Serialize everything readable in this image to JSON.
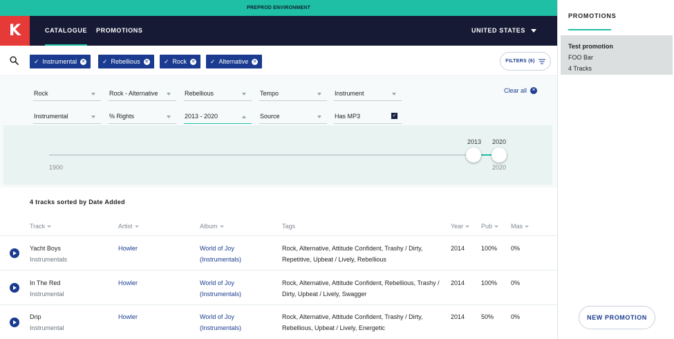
{
  "env_banner": "PREPROD ENVIRONMENT",
  "logo_text": "K",
  "nav": {
    "catalogue": "CATALOGUE",
    "promotions": "PROMOTIONS",
    "country": "UNITED STATES"
  },
  "chips": [
    "Instrumental",
    "Rebellious",
    "Rock",
    "Alternative"
  ],
  "filters_button": "FILTERS (6)",
  "filters": {
    "row1": [
      "Rock",
      "Rock - Alternative",
      "Rebellious",
      "Tempo",
      "Instrument"
    ],
    "row2": [
      "Instrumental",
      "% Rights",
      "2013 - 2020",
      "Source",
      "Has MP3"
    ],
    "clear_all": "Clear all"
  },
  "slider": {
    "min_label": "1900",
    "max_label": "2020",
    "low_value": "2013",
    "high_value": "2020",
    "range_min": 1900,
    "range_max": 2020
  },
  "summary": "4 tracks sorted by Date Added",
  "table": {
    "headers": {
      "track": "Track",
      "artist": "Artist",
      "album": "Album",
      "tags": "Tags",
      "year": "Year",
      "pub": "Pub",
      "mas": "Mas"
    },
    "rows": [
      {
        "track": "Yacht Boys",
        "version": "Instrumentals",
        "artist": "Howler",
        "album_line1": "World of Joy",
        "album_line2": "(Instrumentals)",
        "tags_line1": "Rock, Alternative, Attitude Confident, Trashy / Dirty,",
        "tags_line2": "Repetitive, Upbeat / Lively, Rebellious",
        "year": "2014",
        "pub": "100%",
        "mas": "0%"
      },
      {
        "track": "In The Red",
        "version": "Instrumental",
        "artist": "Howler",
        "album_line1": "World of Joy",
        "album_line2": "(Instrumentals)",
        "tags_line1": "Rock, Alternative, Attitude Confident, Rebellious, Trashy /",
        "tags_line2": "Dirty, Upbeat / Lively, Swagger",
        "year": "2014",
        "pub": "100%",
        "mas": "0%"
      },
      {
        "track": "Drip",
        "version": "Instrumental",
        "artist": "Howler",
        "album_line1": "World of Joy",
        "album_line2": "(Instrumentals)",
        "tags_line1": "Rock, Alternative, Attitude Confident, Trashy / Dirty,",
        "tags_line2": "Rebellious, Upbeat / Lively, Energetic",
        "year": "2014",
        "pub": "50%",
        "mas": "0%"
      }
    ]
  },
  "sidebar": {
    "title": "PROMOTIONS",
    "promo": {
      "title": "Test promotion",
      "subtitle": "FOO Bar",
      "count": "4 Tracks"
    },
    "new_button": "NEW PROMOTION"
  },
  "colors": {
    "accent": "#1ebfa4",
    "navy": "#161a34",
    "brand_red": "#e63a39",
    "link_blue": "#1a3b8f"
  }
}
